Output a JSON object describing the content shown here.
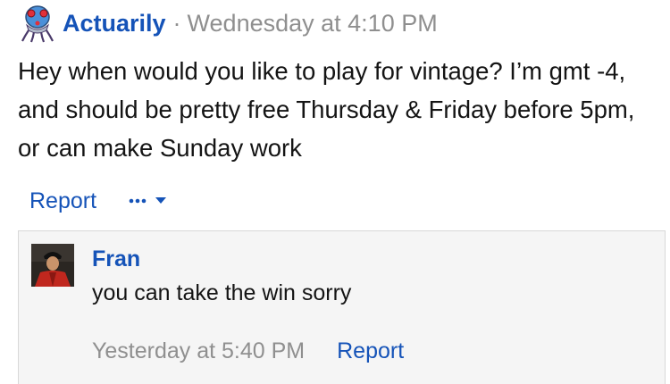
{
  "post": {
    "author": "Actuarily",
    "separator": "·",
    "time": "Wednesday at 4:10 PM",
    "body": "Hey when would you like to play for vintage? I’m gmt -4, and should be pretty free Thursday & Friday before 5pm, or can make Sunday work",
    "report_label": "Report",
    "avatar_icon": "tentacool-avatar-icon",
    "more_icon": "ellipsis-dropdown-icon"
  },
  "reply": {
    "author": "Fran",
    "text": "you can take the win sorry",
    "time": "Yesterday at 5:40 PM",
    "report_label": "Report",
    "avatar_icon": "portrait-avatar"
  },
  "colors": {
    "link": "#1553b8",
    "muted": "#8f8f8f",
    "text": "#141414",
    "reply_bg": "#f5f5f5",
    "reply_border": "#d8d8d8"
  }
}
